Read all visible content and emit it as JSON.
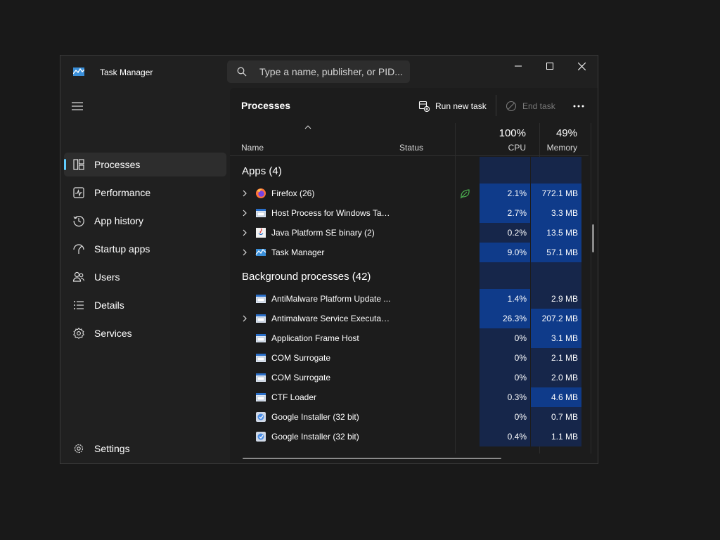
{
  "app": {
    "title": "Task Manager"
  },
  "search": {
    "placeholder": "Type a name, publisher, or PID..."
  },
  "sidebar": {
    "items": [
      {
        "label": "Processes",
        "icon": "processes-icon",
        "selected": true
      },
      {
        "label": "Performance",
        "icon": "performance-icon"
      },
      {
        "label": "App history",
        "icon": "history-icon"
      },
      {
        "label": "Startup apps",
        "icon": "startup-icon"
      },
      {
        "label": "Users",
        "icon": "users-icon"
      },
      {
        "label": "Details",
        "icon": "details-icon"
      },
      {
        "label": "Services",
        "icon": "services-icon"
      }
    ],
    "settings_label": "Settings"
  },
  "toolbar": {
    "page_title": "Processes",
    "run_new_task": "Run new task",
    "end_task": "End task"
  },
  "table": {
    "columns": {
      "name": "Name",
      "status": "Status",
      "cpu_pct": "100%",
      "cpu": "CPU",
      "memory_pct": "49%",
      "memory": "Memory"
    },
    "groups": {
      "apps": "Apps (4)",
      "background": "Background processes (42)"
    },
    "apps": [
      {
        "name": "Firefox (26)",
        "cpu": "2.1%",
        "memory": "772.1 MB",
        "expandable": true,
        "icon": "firefox-icon",
        "efficiency": true
      },
      {
        "name": "Host Process for Windows Tasks",
        "cpu": "2.7%",
        "memory": "3.3 MB",
        "expandable": true,
        "icon": "window-process-icon"
      },
      {
        "name": "Java Platform SE binary (2)",
        "cpu": "0.2%",
        "memory": "13.5 MB",
        "expandable": true,
        "icon": "java-icon"
      },
      {
        "name": "Task Manager",
        "cpu": "9.0%",
        "memory": "57.1 MB",
        "expandable": true,
        "icon": "task-manager-icon"
      }
    ],
    "background": [
      {
        "name": "AntiMalware Platform Update ...",
        "cpu": "1.4%",
        "memory": "2.9 MB",
        "expandable": false,
        "icon": "window-process-icon"
      },
      {
        "name": "Antimalware Service Executable",
        "cpu": "26.3%",
        "memory": "207.2 MB",
        "expandable": true,
        "icon": "window-process-icon"
      },
      {
        "name": "Application Frame Host",
        "cpu": "0%",
        "memory": "3.1 MB",
        "expandable": false,
        "icon": "window-process-icon"
      },
      {
        "name": "COM Surrogate",
        "cpu": "0%",
        "memory": "2.1 MB",
        "expandable": false,
        "icon": "window-process-icon"
      },
      {
        "name": "COM Surrogate",
        "cpu": "0%",
        "memory": "2.0 MB",
        "expandable": false,
        "icon": "window-process-icon"
      },
      {
        "name": "CTF Loader",
        "cpu": "0.3%",
        "memory": "4.6 MB",
        "expandable": false,
        "icon": "window-process-icon"
      },
      {
        "name": "Google Installer (32 bit)",
        "cpu": "0%",
        "memory": "0.7 MB",
        "expandable": false,
        "icon": "installer-icon"
      },
      {
        "name": "Google Installer (32 bit)",
        "cpu": "0.4%",
        "memory": "1.1 MB",
        "expandable": false,
        "icon": "installer-icon"
      }
    ]
  },
  "colors": {
    "accent": "#60cdff",
    "heat_high": "#0f3b8a",
    "heat_low": "#16264a",
    "efficiency": "#4caf50"
  }
}
